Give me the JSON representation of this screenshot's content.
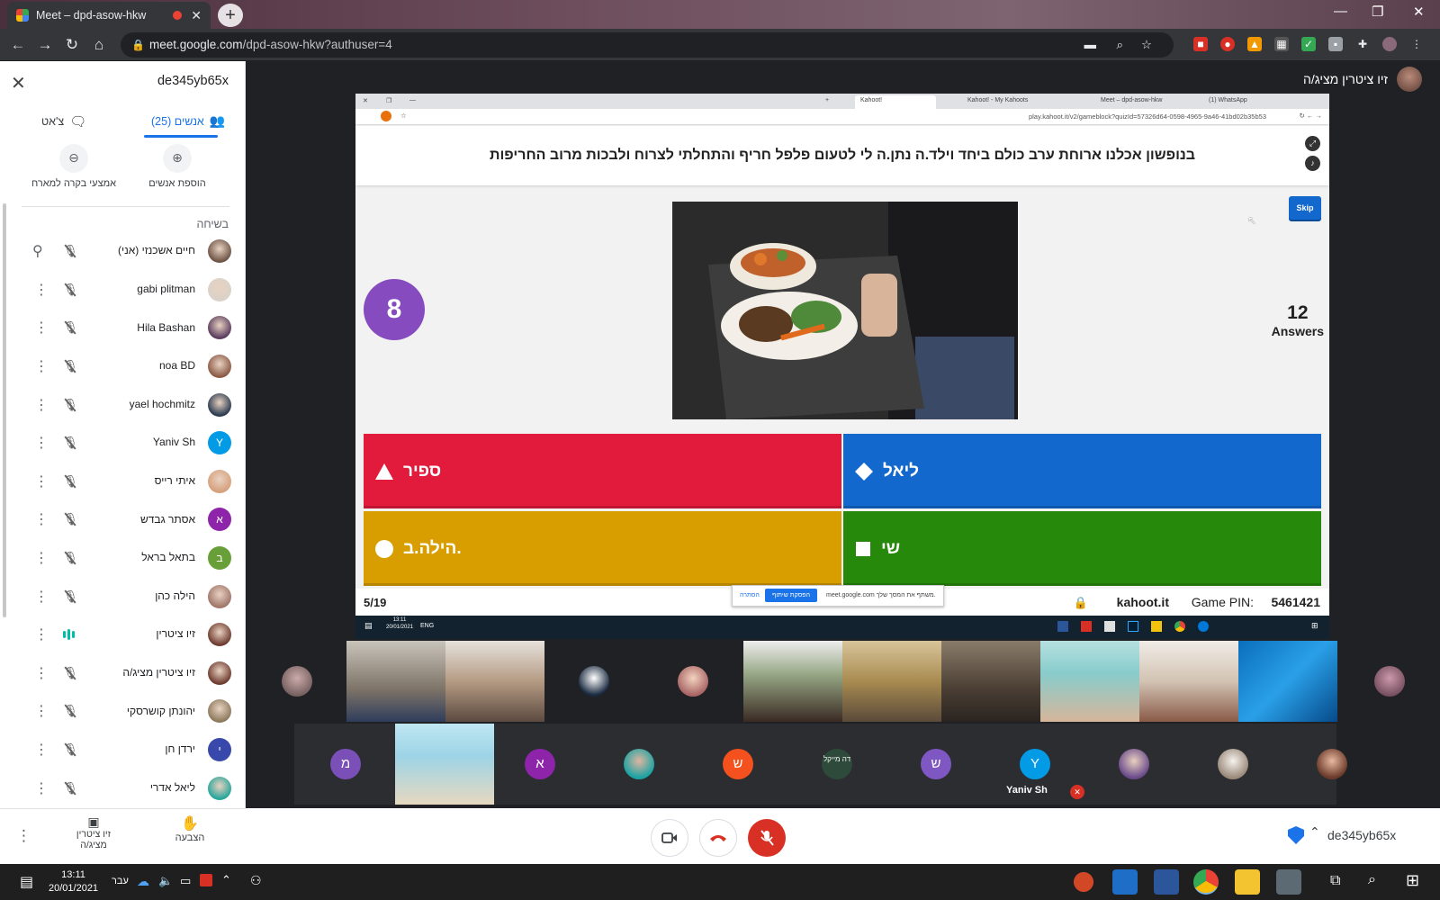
{
  "browser": {
    "tab_title": "Meet – dpd-asow-hkw",
    "new_tab": "+",
    "url_host": "meet.google.com",
    "url_path": "/dpd-asow-hkw?authuser=4",
    "win_min": "—",
    "win_max": "❐",
    "win_close": "✕"
  },
  "panel": {
    "meeting_code": "de345yb65x",
    "tab_people": "אנשים (25)",
    "tab_chat": "צ'אט",
    "add_people": "הוספת אנשים",
    "host_controls": "אמצעי בקרה למארח",
    "section_label": "בשיחה",
    "participants": [
      {
        "name": "חיים אשכנזי (אני)",
        "initial": "",
        "color": "#6d5446",
        "mic": "muted",
        "extra": "pin"
      },
      {
        "name": "gabi plitman",
        "initial": "",
        "color": "#d9d2c8",
        "mic": "muted"
      },
      {
        "name": "Hila Bashan",
        "initial": "",
        "color": "#5a3c5e",
        "mic": "muted"
      },
      {
        "name": "noa BD",
        "initial": "",
        "color": "#8a5a45",
        "mic": "muted"
      },
      {
        "name": "yael hochmitz",
        "initial": "",
        "color": "#2a3a50",
        "mic": "muted"
      },
      {
        "name": "Yaniv Sh",
        "initial": "Y",
        "color": "#039be5",
        "mic": "muted"
      },
      {
        "name": "איתי רייס",
        "initial": "",
        "color": "#d6a07c",
        "mic": "muted"
      },
      {
        "name": "אסתר גבדש",
        "initial": "א",
        "color": "#8e24aa",
        "mic": "muted"
      },
      {
        "name": "בתאל בראל",
        "initial": "ב",
        "color": "#689f38",
        "mic": "muted"
      },
      {
        "name": "הילה כהן",
        "initial": "",
        "color": "#a0766a",
        "mic": "muted"
      },
      {
        "name": "זיו ציטרין",
        "initial": "",
        "color": "#6e3b2f",
        "mic": "speaking"
      },
      {
        "name": "זיו ציטרין מציג/ה",
        "initial": "",
        "color": "#6e3b2f",
        "mic": "present-muted"
      },
      {
        "name": "יהונתן קושרסקי",
        "initial": "",
        "color": "#8c7a5c",
        "mic": "muted"
      },
      {
        "name": "ירדן חן",
        "initial": "י",
        "color": "#3949ab",
        "mic": "muted"
      },
      {
        "name": "ליאל אדרי",
        "initial": "",
        "color": "#26a69a",
        "mic": "muted"
      }
    ],
    "present_label": "זיו ציטרין מציג/ה",
    "raise_hand": "הצבעה"
  },
  "stage": {
    "presenter_label": "זיו ציטרין מציג/ה"
  },
  "kahoot": {
    "inner_tabs": [
      "Kahoot!",
      "Kahoot! - My Kahoots",
      "Meet – dpd-asow-hkw",
      "(1) WhatsApp"
    ],
    "inner_url": "play.kahoot.it/v2/gameblock?quizId=57326d64-0598-4965-9a46-41bd02b35b53",
    "question": "בנופשון אכלנו ארוחת ערב כולם ביחד וילד.ה נתן.ה לי לטעום פלפל חריף והתחלתי לצרוח ולבכות מרוב החריפות",
    "timer": "8",
    "answers_count": "12",
    "answers_label": "Answers",
    "skip": "Skip",
    "answers": [
      {
        "label": "ספיר",
        "shape": "triangle",
        "color": "#e21b3c"
      },
      {
        "label": "ליאל",
        "shape": "diamond",
        "color": "#1368ce"
      },
      {
        "label": "הילה.ב.",
        "shape": "circle",
        "color": "#d89e00"
      },
      {
        "label": "שי",
        "shape": "square",
        "color": "#26890c"
      }
    ],
    "progress": "5/19",
    "brand": "kahoot.it",
    "pin_label": "Game PIN:",
    "pin": "5461421",
    "share_bar_text": "meet.google.com משתף את המסך שלך.",
    "share_stop": "הפסקת שיתוף",
    "share_hide": "הסתרה",
    "inner_time": "13:11",
    "inner_date": "20/01/2021",
    "inner_lang": "ENG"
  },
  "tiles": {
    "row2_initials": [
      "מ",
      "א",
      "",
      "ש",
      "דה מייקל",
      "ש",
      "Y"
    ],
    "yaniv_label": "Yaniv Sh"
  },
  "meetbar": {
    "meeting_code": "de345yb65x"
  },
  "taskbar": {
    "time": "13:11",
    "date": "20/01/2021",
    "lang": "עבר"
  }
}
